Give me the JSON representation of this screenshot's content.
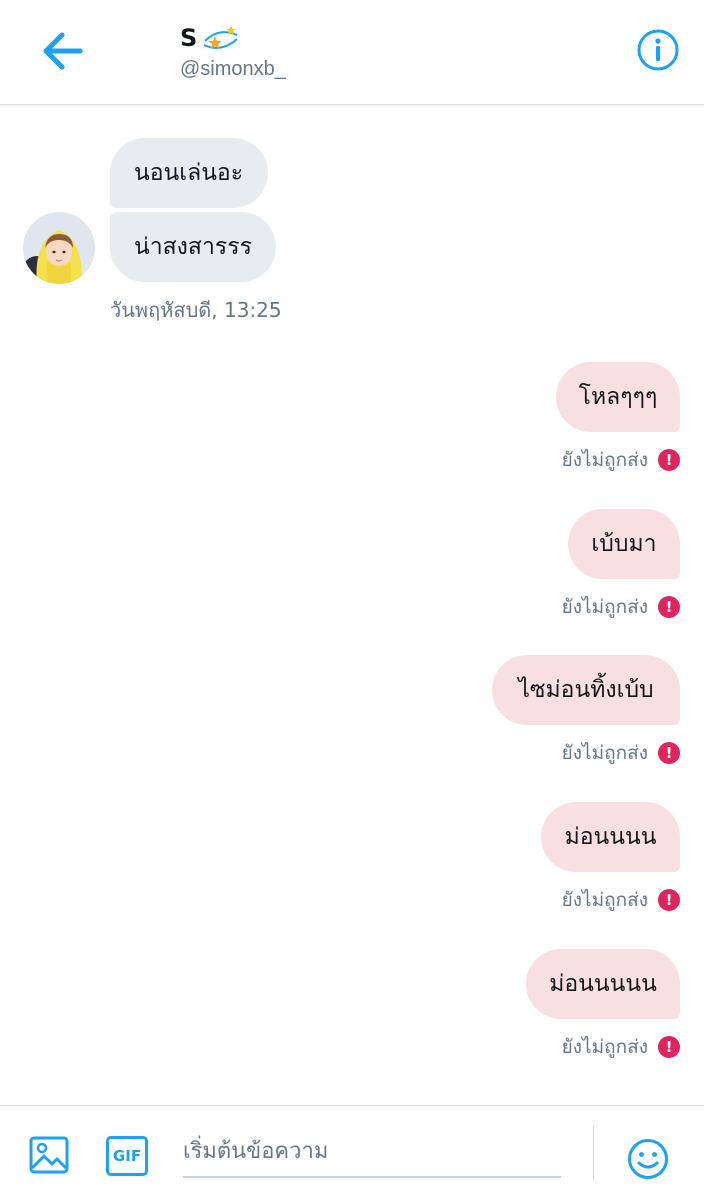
{
  "header": {
    "title": "S",
    "handle": "@simonxb_"
  },
  "incoming": {
    "messages": [
      "นอนเล่นอะ",
      "น่าสงสารรร"
    ],
    "timestamp": "วันพฤหัสบดี, 13:25"
  },
  "outgoing": {
    "messages": [
      {
        "text": "โหลๆๆๆ",
        "status": "ยังไม่ถูกส่ง"
      },
      {
        "text": "เบ้บมา",
        "status": "ยังไม่ถูกส่ง"
      },
      {
        "text": "ไซม่อนทิ้งเบ้บ",
        "status": "ยังไม่ถูกส่ง"
      },
      {
        "text": "ม่อนนนน",
        "status": "ยังไม่ถูกส่ง"
      },
      {
        "text": "ม่อนนนนน",
        "status": "ยังไม่ถูกส่ง"
      }
    ],
    "error_glyph": "!"
  },
  "composer": {
    "placeholder": "เริ่มต้นข้อความ",
    "gif_label": "GIF"
  },
  "colors": {
    "accent": "#1da1f2",
    "incoming_bubble": "#e6ecf0",
    "outgoing_bubble": "#f8dfe2",
    "error": "#e0245e"
  },
  "icons": [
    "back-arrow-icon",
    "sparkle-stars-icon",
    "info-icon",
    "image-icon",
    "gif-icon",
    "emoji-icon",
    "error-icon"
  ]
}
